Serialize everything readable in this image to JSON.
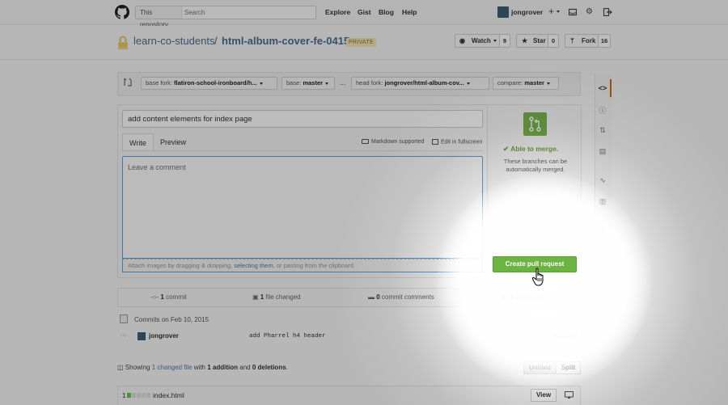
{
  "header": {
    "search_scope": "This repository",
    "search_placeholder": "Search",
    "nav": [
      "Explore",
      "Gist",
      "Blog",
      "Help"
    ],
    "username": "jongrover",
    "icons": [
      "github-logo-icon",
      "plus-icon",
      "inbox-icon",
      "gear-icon",
      "sign-out-icon"
    ]
  },
  "repo": {
    "owner": "learn-co-students",
    "separator": "/",
    "name": "html-album-cover-fe-0415",
    "visibility": "PRIVATE",
    "watch_label": "Watch",
    "watch_count": "9",
    "star_label": "Star",
    "star_count": "0",
    "fork_label": "Fork",
    "fork_count": "16"
  },
  "compare": {
    "base_fork_label": "base fork:",
    "base_fork_value": "flatiron-school-ironboard/h...",
    "base_label": "base:",
    "base_value": "master",
    "ellipsis": "...",
    "head_fork_label": "head fork:",
    "head_fork_value": "jongrover/html-album-cov...",
    "compare_label": "compare:",
    "compare_value": "master"
  },
  "form": {
    "title_value": "add content elements for index page",
    "tab_write": "Write",
    "tab_preview": "Preview",
    "markdown_note": "Markdown supported",
    "fullscreen_note": "Edit in fullscreen",
    "comment_placeholder": "Leave a comment",
    "attach_prefix": "Attach images by dragging & dropping, ",
    "attach_link": "selecting them",
    "attach_suffix": ", or pasting from the clipboard."
  },
  "merge": {
    "status": "Able to merge.",
    "description": "These branches can be automatically merged.",
    "create_button": "Create pull request",
    "accent": "#6cb341"
  },
  "stats": {
    "commits_count": "1",
    "commits_label": "commit",
    "files_count": "1",
    "files_label": "file changed",
    "comments_count": "0",
    "comments_label": "commit comments",
    "contributors_count": "1",
    "contributors_label": "contributor"
  },
  "commits": {
    "heading": "Commits on Feb 10, 2015",
    "items": [
      {
        "author": "jongrover",
        "message": "add Pharrel h4 header",
        "sha": "8d822ef"
      }
    ]
  },
  "summary": {
    "showing": "Showing",
    "changed_count": "1",
    "changed_label": "changed file",
    "with": "with",
    "additions": "1 addition",
    "and": "and",
    "deletions": "0 deletions",
    "period": ".",
    "unified": "Unified",
    "split": "Split"
  },
  "file": {
    "diff_count": "1",
    "name": "index.html",
    "view_label": "View"
  }
}
